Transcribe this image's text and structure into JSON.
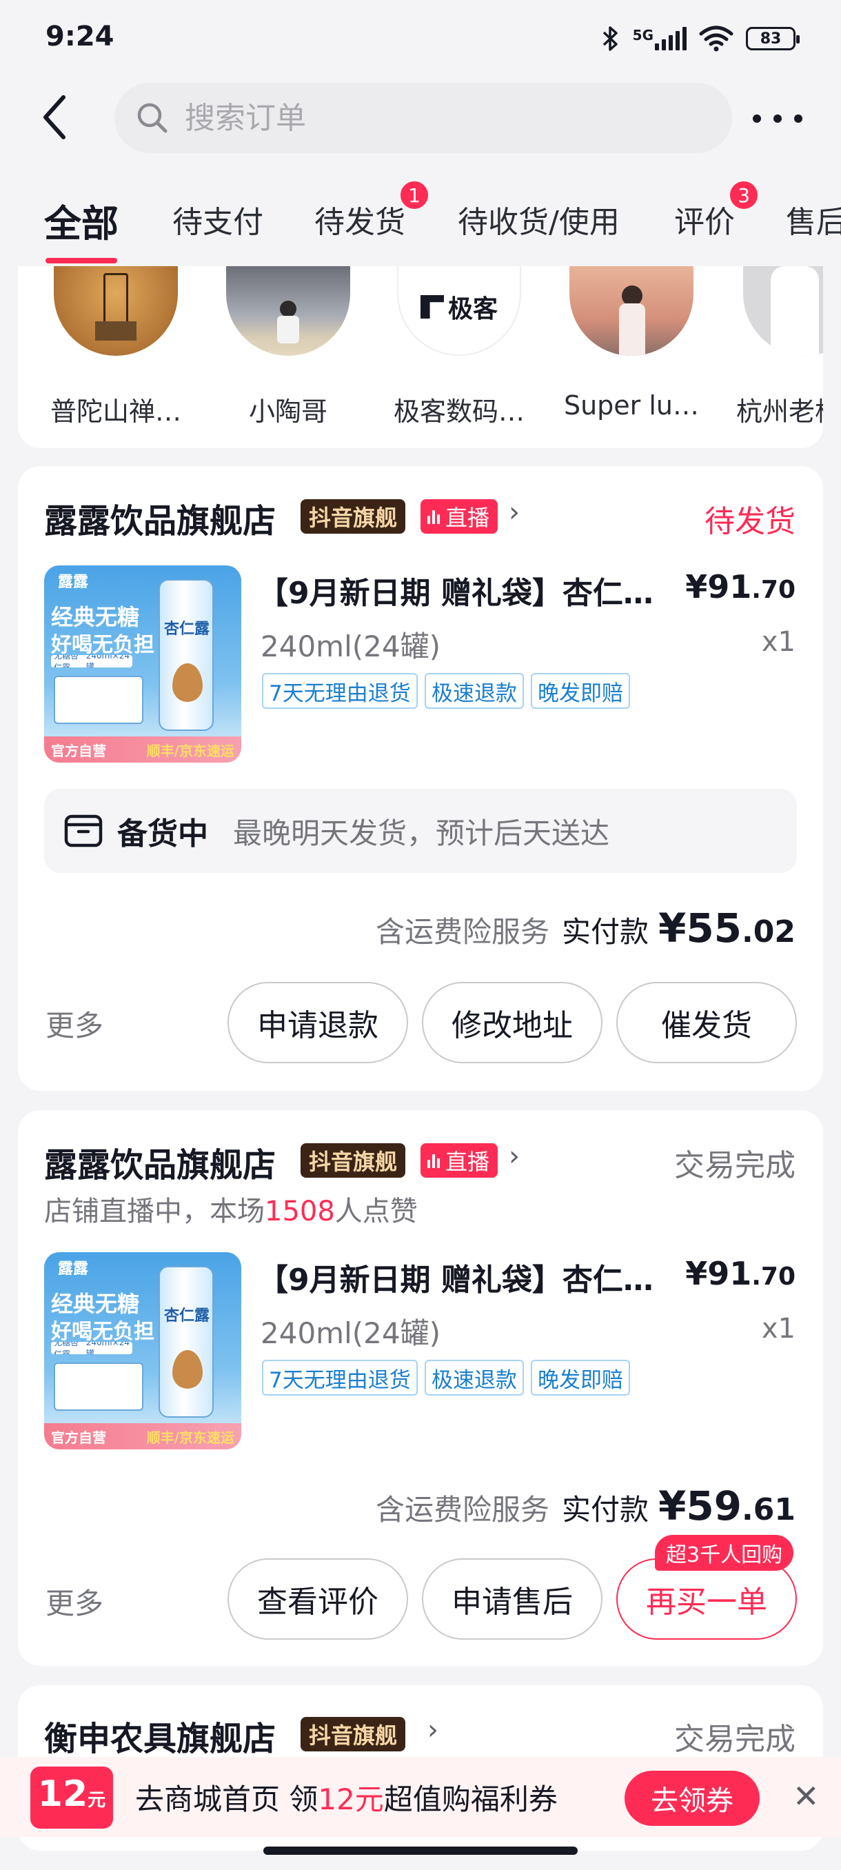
{
  "status_bar": {
    "time": "9:24",
    "network": "5G",
    "battery": "83",
    "icons": [
      "bluetooth-icon",
      "cellular-signal-icon",
      "wifi-icon",
      "battery-icon"
    ]
  },
  "header": {
    "search_placeholder": "搜索订单",
    "back_icon": "chevron-left-icon",
    "more_icon": "more-dots-icon"
  },
  "tabs": [
    {
      "label": "全部",
      "active": true
    },
    {
      "label": "待支付"
    },
    {
      "label": "待发货",
      "badge": "1"
    },
    {
      "label": "待收货/使用"
    },
    {
      "label": "评价",
      "badge": "3"
    },
    {
      "label": "售后"
    }
  ],
  "shops": [
    {
      "name": "普陀山禅…"
    },
    {
      "name": "小陶哥"
    },
    {
      "name": "极客数码…",
      "logo_text": "极客"
    },
    {
      "name": "Super lu…"
    },
    {
      "name": "杭州老杭"
    }
  ],
  "orders": [
    {
      "store": "露露饮品旗舰店",
      "brand_tag": "抖音旗舰",
      "live_tag": "直播",
      "status": "待发货",
      "status_color": "#fe2c55",
      "product": {
        "title": "【9月新日期 赠礼袋】杏仁…",
        "spec": "240ml(24罐)",
        "price_int": "¥91",
        "price_dec": ".70",
        "qty": "x1",
        "image_text": {
          "brand": "露露",
          "slogan1": "经典无糖",
          "slogan2": "好喝无负担",
          "can_name": "杏仁露",
          "sub": "无糖杏仁露",
          "pack": "240ml×24罐",
          "corner": "官方自营",
          "delivery": "顺丰/京东速运"
        },
        "service_tags": [
          "7天无理由退货",
          "极速退款",
          "晚发即赔"
        ]
      },
      "shipping": {
        "label": "备货中",
        "desc": "最晚明天发货，预计后天送达"
      },
      "payment": {
        "insurance": "含运费险服务",
        "label": "实付款",
        "amount_int": "¥55",
        "amount_dec": ".02"
      },
      "more": "更多",
      "buttons": [
        "申请退款",
        "修改地址",
        "催发货"
      ]
    },
    {
      "store": "露露饮品旗舰店",
      "brand_tag": "抖音旗舰",
      "live_tag": "直播",
      "status": "交易完成",
      "status_color": "#75767c",
      "live_note_prefix": "店铺直播中，本场",
      "live_note_count": "1508",
      "live_note_suffix": "人点赞",
      "product": {
        "title": "【9月新日期 赠礼袋】杏仁…",
        "spec": "240ml(24罐)",
        "price_int": "¥91",
        "price_dec": ".70",
        "qty": "x1",
        "image_text": {
          "brand": "露露",
          "slogan1": "经典无糖",
          "slogan2": "好喝无负担",
          "can_name": "杏仁露",
          "sub": "无糖杏仁露",
          "pack": "240ml×24罐",
          "corner": "官方自营",
          "delivery": "顺丰/京东速运"
        },
        "service_tags": [
          "7天无理由退货",
          "极速退款",
          "晚发即赔"
        ]
      },
      "payment": {
        "insurance": "含运费险服务",
        "label": "实付款",
        "amount_int": "¥59",
        "amount_dec": ".61"
      },
      "more": "更多",
      "buttons": [
        "查看评价",
        "申请售后",
        "再买一单"
      ],
      "buy_again_badge": "超3千人回购"
    },
    {
      "store": "衡申农具旗舰店",
      "brand_tag": "抖音旗舰",
      "status": "交易完成",
      "status_color": "#75767c"
    }
  ],
  "coupon_banner": {
    "badge_amount": "12",
    "badge_unit": "元",
    "text_prefix": "去商城首页 领",
    "text_amount": "12元",
    "text_suffix": "超值购福利券",
    "button": "去领券",
    "close_icon": "close-icon"
  },
  "colors": {
    "accent": "#fe2c55",
    "brand_tag_bg": "#3b2416",
    "brand_tag_text": "#f5d6a7",
    "service_tag": "#1a7fd1"
  }
}
